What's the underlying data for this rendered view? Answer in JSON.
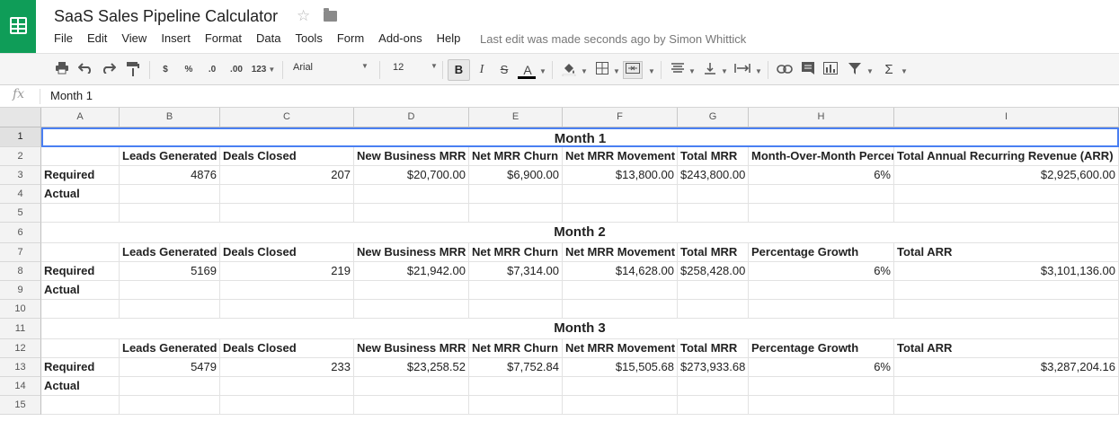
{
  "app": {
    "doc_title": "SaaS Sales Pipeline Calculator",
    "star_icon": "star-icon",
    "folder_icon": "folder-icon",
    "menu": [
      "File",
      "Edit",
      "View",
      "Insert",
      "Format",
      "Data",
      "Tools",
      "Form",
      "Add-ons",
      "Help"
    ],
    "last_edit": "Last edit was made seconds ago by Simon Whittick"
  },
  "toolbar": {
    "currency": "$",
    "percent": "%",
    "dec_decrease": ".0",
    "dec_increase": ".00",
    "more_formats": "123",
    "font": "Arial",
    "font_size": "12",
    "bold": "B",
    "italic": "I",
    "strike": "S",
    "text_color": "A",
    "sigma": "Σ"
  },
  "formula_bar": {
    "fx": "fx",
    "value": "Month 1"
  },
  "columns": [
    "A",
    "B",
    "C",
    "D",
    "E",
    "F",
    "G",
    "H",
    "I"
  ],
  "rows": [
    "1",
    "2",
    "3",
    "4",
    "5",
    "6",
    "7",
    "8",
    "9",
    "10",
    "11",
    "12",
    "13",
    "14",
    "15"
  ],
  "sheet": {
    "month1": {
      "title": "Month 1",
      "headers": [
        "Leads Generated",
        "Deals Closed",
        "New Business MRR",
        "Net MRR Churn",
        "Net MRR Movement",
        "Total MRR",
        "Month-Over-Month Percentage Growth",
        "Total Annual Recurring Revenue (ARR)"
      ],
      "required_label": "Required",
      "required": [
        "4876",
        "207",
        "$20,700.00",
        "$6,900.00",
        "$13,800.00",
        "$243,800.00",
        "6%",
        "$2,925,600.00"
      ],
      "actual_label": "Actual"
    },
    "month2": {
      "title": "Month 2",
      "headers": [
        "Leads Generated",
        "Deals Closed",
        "New Business MRR",
        "Net MRR Churn",
        "Net MRR Movement",
        "Total MRR",
        "Percentage Growth",
        "Total ARR"
      ],
      "required_label": "Required",
      "required": [
        "5169",
        "219",
        "$21,942.00",
        "$7,314.00",
        "$14,628.00",
        "$258,428.00",
        "6%",
        "$3,101,136.00"
      ],
      "actual_label": "Actual"
    },
    "month3": {
      "title": "Month 3",
      "headers": [
        "Leads Generated",
        "Deals Closed",
        "New Business MRR",
        "Net MRR Churn",
        "Net MRR Movement",
        "Total MRR",
        "Percentage Growth",
        "Total ARR"
      ],
      "required_label": "Required",
      "required": [
        "5479",
        "233",
        "$23,258.52",
        "$7,752.84",
        "$15,505.68",
        "$273,933.68",
        "6%",
        "$3,287,204.16"
      ],
      "actual_label": "Actual"
    }
  }
}
